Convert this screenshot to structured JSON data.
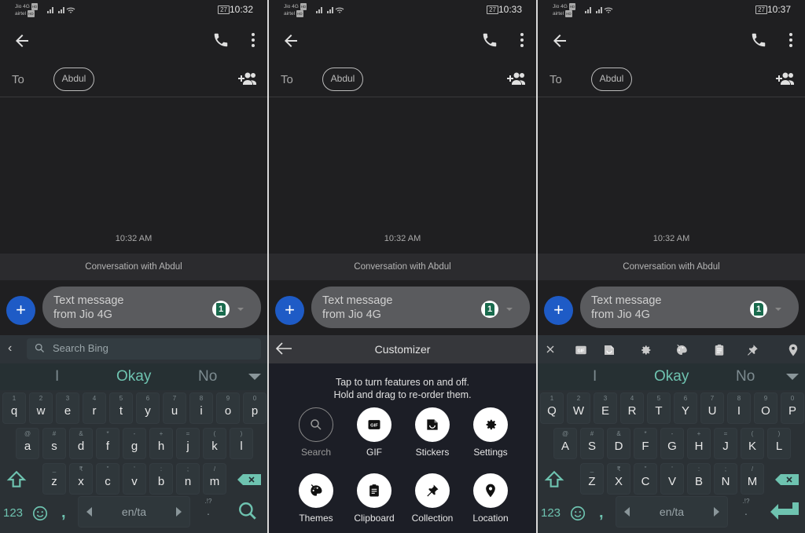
{
  "panels": [
    {
      "status": {
        "carrier1": "Jio 4G",
        "carrier2": "airtel",
        "battery": "27",
        "time": "10:32"
      },
      "to_label": "To",
      "recipient": "Abdul",
      "timestamp": "10:32 AM",
      "conversation_label": "Conversation with Abdul",
      "compose_placeholder": [
        "Text message",
        "from Jio 4G"
      ],
      "sim_number": "1",
      "search_placeholder": "Search Bing",
      "suggestions": [
        "I",
        "Okay",
        "No"
      ],
      "rows": {
        "r1": [
          [
            "1",
            "q"
          ],
          [
            "2",
            "w"
          ],
          [
            "3",
            "e"
          ],
          [
            "4",
            "r"
          ],
          [
            "5",
            "t"
          ],
          [
            "6",
            "y"
          ],
          [
            "7",
            "u"
          ],
          [
            "8",
            "i"
          ],
          [
            "9",
            "o"
          ],
          [
            "0",
            "p"
          ]
        ],
        "r2": [
          [
            "@",
            "a"
          ],
          [
            "#",
            "s"
          ],
          [
            "&",
            "d"
          ],
          [
            "*",
            "f"
          ],
          [
            "-",
            "g"
          ],
          [
            "+",
            "h"
          ],
          [
            "=",
            "j"
          ],
          [
            "(",
            "k"
          ],
          [
            ")",
            "l"
          ]
        ],
        "r3": [
          [
            "_",
            "z"
          ],
          [
            "₹",
            "x"
          ],
          [
            "\"",
            "c"
          ],
          [
            "'",
            "v"
          ],
          [
            ":",
            "b"
          ],
          [
            ";",
            "n"
          ],
          [
            "/",
            "m"
          ]
        ]
      },
      "bottom": {
        "num": "123",
        "comma": ",",
        "space": "en/ta",
        "punct_hint": ".!?",
        "punct": "."
      }
    },
    {
      "status": {
        "carrier1": "Jio 4G",
        "carrier2": "airtel",
        "battery": "27",
        "time": "10:33"
      },
      "to_label": "To",
      "recipient": "Abdul",
      "timestamp": "10:32 AM",
      "conversation_label": "Conversation with Abdul",
      "compose_placeholder": [
        "Text message",
        "from Jio 4G"
      ],
      "sim_number": "1",
      "customizer": {
        "title": "Customizer",
        "info": [
          "Tap to turn features on and off.",
          "Hold and drag to re-order them."
        ],
        "features": [
          {
            "label": "Search",
            "icon": "search-icon",
            "enabled": false
          },
          {
            "label": "GIF",
            "icon": "gif-icon",
            "enabled": true
          },
          {
            "label": "Stickers",
            "icon": "sticker-icon",
            "enabled": true
          },
          {
            "label": "Settings",
            "icon": "gear-icon",
            "enabled": true
          },
          {
            "label": "Themes",
            "icon": "palette-icon",
            "enabled": true
          },
          {
            "label": "Clipboard",
            "icon": "clipboard-icon",
            "enabled": true
          },
          {
            "label": "Collection",
            "icon": "pin-icon",
            "enabled": true
          },
          {
            "label": "Location",
            "icon": "location-icon",
            "enabled": true
          }
        ]
      }
    },
    {
      "status": {
        "carrier1": "Jio 4G",
        "carrier2": "airtel",
        "battery": "27",
        "time": "10:37"
      },
      "to_label": "To",
      "recipient": "Abdul",
      "timestamp": "10:32 AM",
      "conversation_label": "Conversation with Abdul",
      "compose_placeholder": [
        "Text message",
        "from Jio 4G"
      ],
      "sim_number": "1",
      "toolbar": [
        "close-icon",
        "gif-icon",
        "sticker-icon",
        "gear-icon",
        "palette-icon",
        "clipboard-icon",
        "pin-icon",
        "location-icon"
      ],
      "suggestions": [
        "I",
        "Okay",
        "No"
      ],
      "rows": {
        "r1": [
          [
            "1",
            "Q"
          ],
          [
            "2",
            "W"
          ],
          [
            "3",
            "E"
          ],
          [
            "4",
            "R"
          ],
          [
            "5",
            "T"
          ],
          [
            "6",
            "Y"
          ],
          [
            "7",
            "U"
          ],
          [
            "8",
            "I"
          ],
          [
            "9",
            "O"
          ],
          [
            "0",
            "P"
          ]
        ],
        "r2": [
          [
            "@",
            "A"
          ],
          [
            "#",
            "S"
          ],
          [
            "&",
            "D"
          ],
          [
            "*",
            "F"
          ],
          [
            "-",
            "G"
          ],
          [
            "+",
            "H"
          ],
          [
            "=",
            "J"
          ],
          [
            "(",
            "K"
          ],
          [
            ")",
            "L"
          ]
        ],
        "r3": [
          [
            "_",
            "Z"
          ],
          [
            "₹",
            "X"
          ],
          [
            "\"",
            "C"
          ],
          [
            "'",
            "V"
          ],
          [
            ":",
            "B"
          ],
          [
            ";",
            "N"
          ],
          [
            "/",
            "M"
          ]
        ]
      },
      "bottom": {
        "num": "123",
        "comma": ",",
        "space": "en/ta",
        "punct_hint": ".!?",
        "punct": "."
      }
    }
  ],
  "colors": {
    "accent_teal": "#6ec3b0",
    "fab_blue": "#1e5bc6",
    "sim_green": "#1a6b4e"
  }
}
